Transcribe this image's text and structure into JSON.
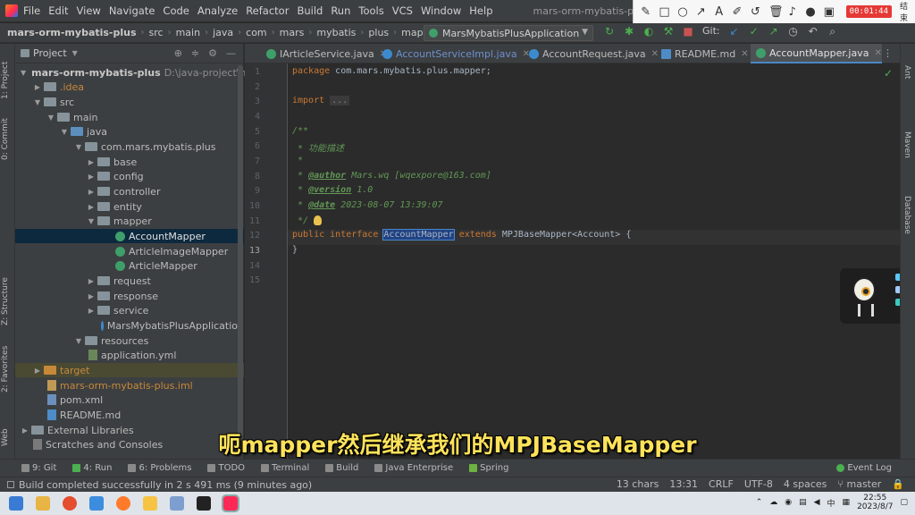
{
  "menubar": {
    "items": [
      "File",
      "Edit",
      "View",
      "Navigate",
      "Code",
      "Analyze",
      "Refactor",
      "Build",
      "Run",
      "Tools",
      "VCS",
      "Window",
      "Help"
    ],
    "title": "mars-orm-mybatis-plus - Accoun"
  },
  "recorder": {
    "icons": [
      "pen-icon",
      "square-icon",
      "circle-icon",
      "arrow-icon",
      "text-icon",
      "marker-icon",
      "undo-icon",
      "trash-icon",
      "volume-icon",
      "mic-icon",
      "camera-icon"
    ],
    "timer": "00:01:44",
    "end_label": "结束"
  },
  "breadcrumb": [
    "mars-orm-mybatis-plus",
    "src",
    "main",
    "java",
    "com",
    "mars",
    "mybatis",
    "plus",
    "map"
  ],
  "run_config": {
    "label": "MarsMybatisPlusApplication"
  },
  "nav_git_label": "Git:",
  "leftstrip": {
    "project": "1: Project",
    "commit": "0: Commit",
    "structure": "Z: Structure",
    "favorites": "2: Favorites",
    "web": "Web"
  },
  "rightstrip": {
    "ant": "Ant",
    "maven": "Maven",
    "database": "Database"
  },
  "project_panel": {
    "title": "Project",
    "tree": [
      {
        "label": "mars-orm-mybatis-plus",
        "extra": "D:\\java-project\\m"
      },
      {
        "label": ".idea"
      },
      {
        "label": "src"
      },
      {
        "label": "main"
      },
      {
        "label": "java"
      },
      {
        "label": "com.mars.mybatis.plus"
      },
      {
        "label": "base"
      },
      {
        "label": "config"
      },
      {
        "label": "controller"
      },
      {
        "label": "entity"
      },
      {
        "label": "mapper"
      },
      {
        "label": "AccountMapper"
      },
      {
        "label": "ArticleImageMapper"
      },
      {
        "label": "ArticleMapper"
      },
      {
        "label": "request"
      },
      {
        "label": "response"
      },
      {
        "label": "service"
      },
      {
        "label": "MarsMybatisPlusApplication"
      },
      {
        "label": "resources"
      },
      {
        "label": "application.yml"
      },
      {
        "label": "target"
      },
      {
        "label": "mars-orm-mybatis-plus.iml"
      },
      {
        "label": "pom.xml"
      },
      {
        "label": "README.md"
      },
      {
        "label": "External Libraries"
      },
      {
        "label": "Scratches and Consoles"
      }
    ]
  },
  "tabs": [
    "IArticleService.java",
    "AccountServiceImpl.java",
    "AccountRequest.java",
    "README.md",
    "AccountMapper.java"
  ],
  "editor": {
    "line_numbers": [
      "1",
      "2",
      "3",
      "4",
      "5",
      "6",
      "7",
      "8",
      "9",
      "10",
      "11",
      "12",
      "13",
      "14",
      "15"
    ],
    "package_kw": "package",
    "package_name": " com.mars.mybatis.plus.mapper;",
    "import_kw": "import",
    "import_dots": "...",
    "javadoc_open": "/**",
    "desc": " * 功能描述",
    "star": " *",
    "author_tag": "@author",
    "author_val": " Mars.wq [wqexpore@163.com]",
    "version_tag": "@version",
    "version_val": " 1.0",
    "date_tag": "@date",
    "date_val": " 2023-08-07 13:39:07",
    "javadoc_close": " */",
    "public_kw": "public",
    "interface_kw": "interface",
    "class_name": "AccountMapper",
    "extends_kw": "extends",
    "base_type": " MPJBaseMapper<Account>",
    "open_brace": "{",
    "close_brace": "}"
  },
  "toolwindows": [
    "9: Git",
    "4: Run",
    "6: Problems",
    "TODO",
    "Terminal",
    "Build",
    "Java Enterprise",
    "Spring"
  ],
  "event_log": "Event Log",
  "status": {
    "message": "Build completed successfully in 2 s 491 ms (9 minutes ago)",
    "chars": "13 chars",
    "position": "13:31",
    "line_sep": "CRLF",
    "encoding": "UTF-8",
    "indent": "4 spaces",
    "branch": "master"
  },
  "subtitle": "呃mapper然后继承我们的MPJBaseMapper",
  "clock": {
    "time": "22:55",
    "date": "2023/8/7"
  },
  "colors": {
    "accent": "#4a88c7",
    "selection": "#214283",
    "keyword": "#cc7832",
    "comment": "#629755",
    "subtitle": "#ffe35a"
  }
}
